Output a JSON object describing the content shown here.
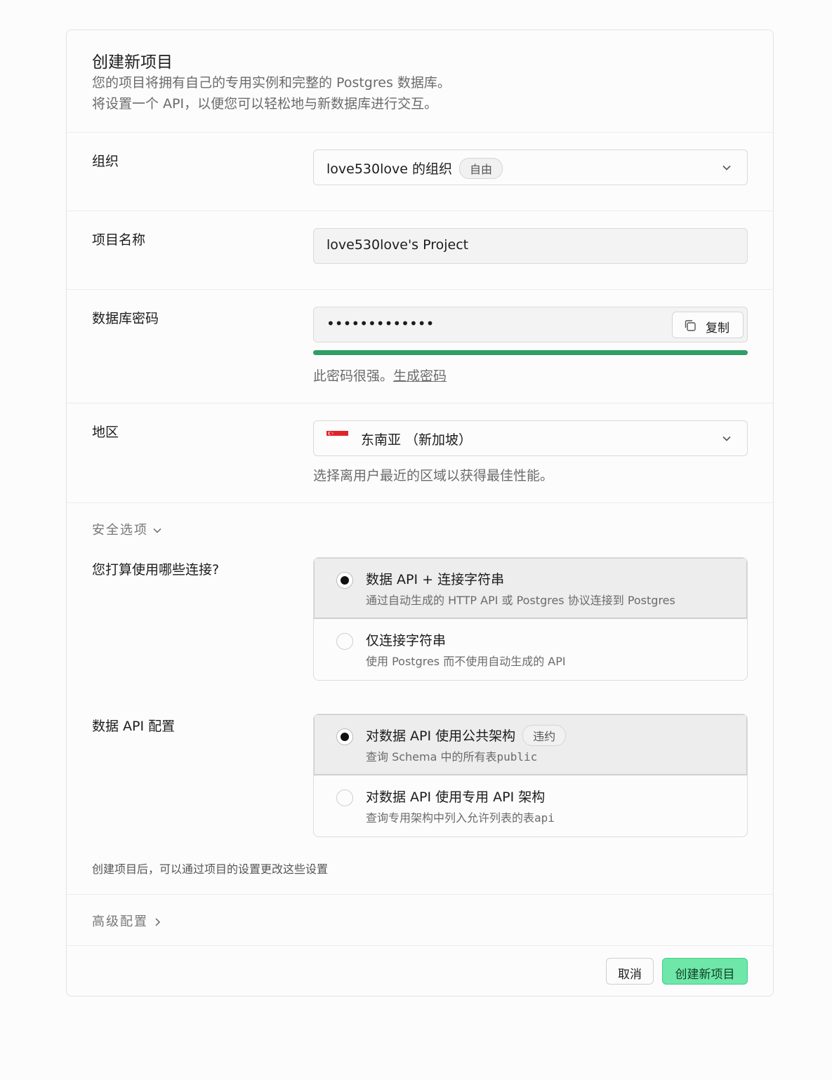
{
  "header": {
    "title": "创建新项目",
    "desc_line1": "您的项目将拥有自己的专用实例和完整的 Postgres 数据库。",
    "desc_line2": "将设置一个 API，以便您可以轻松地与新数据库进行交互。"
  },
  "org": {
    "label": "组织",
    "value": "love530love 的组织",
    "badge": "自由"
  },
  "project_name": {
    "label": "项目名称",
    "value": "love530love's Project"
  },
  "db_password": {
    "label": "数据库密码",
    "value": "•••••••••••••",
    "copy_label": "复制",
    "strength": 1.0,
    "strength_color": "#2f9e67",
    "help": "此密码很强。",
    "generate_link": "生成密码"
  },
  "region": {
    "label": "地区",
    "value": "东南亚 （新加坡）",
    "flag_icon": "singapore-flag-icon",
    "help": "选择离用户最近的区域以获得最佳性能。"
  },
  "security": {
    "toggle_label": "安全选项",
    "connections": {
      "label": "您打算使用哪些连接?",
      "options": [
        {
          "title": "数据 API + 连接字符串",
          "subtitle": "通过自动生成的 HTTP API 或 Postgres 协议连接到 Postgres",
          "selected": true
        },
        {
          "title": "仅连接字符串",
          "subtitle": "使用 Postgres 而不使用自动生成的 API",
          "selected": false
        }
      ]
    },
    "data_api": {
      "label": "数据 API 配置",
      "options": [
        {
          "title": "对数据 API 使用公共架构",
          "badge": "违约",
          "subtitle": "查询 Schema 中的所有表",
          "code": "public",
          "selected": true
        },
        {
          "title": "对数据 API 使用专用 API 架构",
          "subtitle": "查询专用架构中列入允许列表的表",
          "code": "api",
          "selected": false
        }
      ]
    },
    "note": "创建项目后，可以通过项目的设置更改这些设置"
  },
  "advanced": {
    "toggle_label": "高级配置"
  },
  "footer": {
    "cancel_label": "取消",
    "create_label": "创建新项目"
  },
  "colors": {
    "accent": "#3ecf8e",
    "accent_fill": "#6ee7a8"
  }
}
